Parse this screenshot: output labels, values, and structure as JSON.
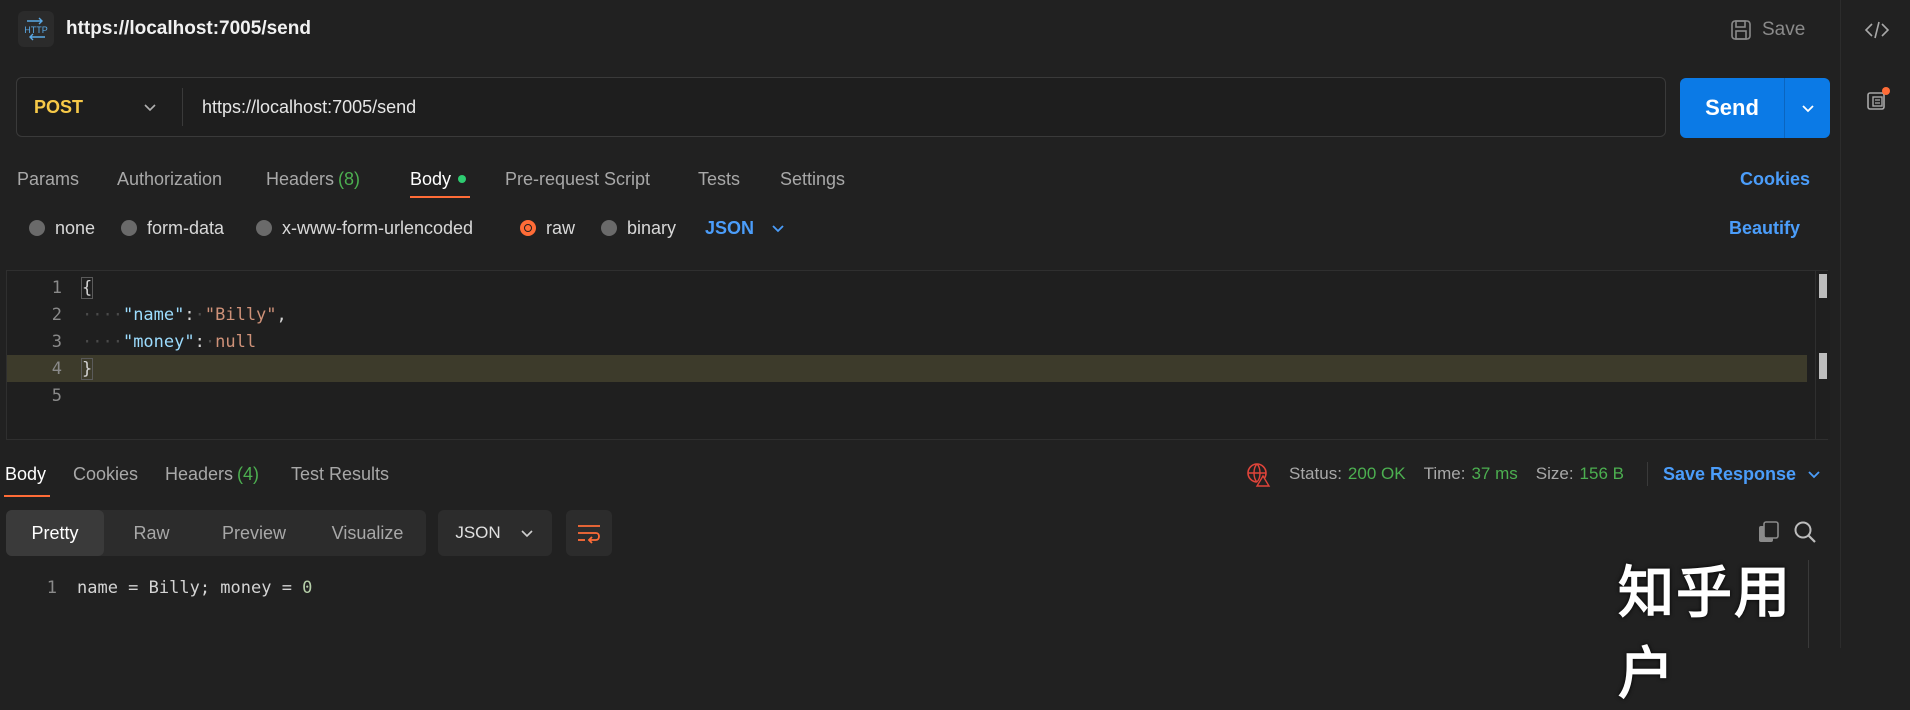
{
  "header": {
    "title": "https://localhost:7005/send",
    "save_label": "Save",
    "http_icon_label": "HTTP"
  },
  "request": {
    "method": "POST",
    "url": "https://localhost:7005/send",
    "send_label": "Send"
  },
  "request_tabs": {
    "params": "Params",
    "authorization": "Authorization",
    "headers": "Headers",
    "headers_count": "(8)",
    "body": "Body",
    "prerequest": "Pre-request Script",
    "tests": "Tests",
    "settings": "Settings",
    "cookies": "Cookies"
  },
  "body_types": {
    "none": "none",
    "form_data": "form-data",
    "urlencoded": "x-www-form-urlencoded",
    "raw": "raw",
    "binary": "binary",
    "format": "JSON",
    "beautify": "Beautify",
    "selected": "raw"
  },
  "editor": {
    "line_numbers": [
      "1",
      "2",
      "3",
      "4",
      "5"
    ],
    "open_brace": "{",
    "close_brace": "}",
    "key1": "\"name\"",
    "val1": "\"Billy\"",
    "key2": "\"money\"",
    "val2": "null",
    "current_line": 4
  },
  "response_tabs": {
    "body": "Body",
    "cookies": "Cookies",
    "headers": "Headers",
    "headers_count": "(4)",
    "test_results": "Test Results"
  },
  "response_status": {
    "status_label": "Status:",
    "status_value": "200 OK",
    "time_label": "Time:",
    "time_value": "37 ms",
    "size_label": "Size:",
    "size_value": "156 B",
    "save_response": "Save Response"
  },
  "response_view": {
    "pretty": "Pretty",
    "raw": "Raw",
    "preview": "Preview",
    "visualize": "Visualize",
    "format": "JSON",
    "line_number": "1",
    "line_text": "name = Billy; money = ",
    "line_num_value": "0"
  },
  "watermark": "知乎用户",
  "colors": {
    "accent_orange": "#ff6c37",
    "send_blue": "#0b7ae6",
    "link_blue": "#4b9dfa",
    "success_green": "#4caf50",
    "method_yellow": "#f7c948"
  }
}
